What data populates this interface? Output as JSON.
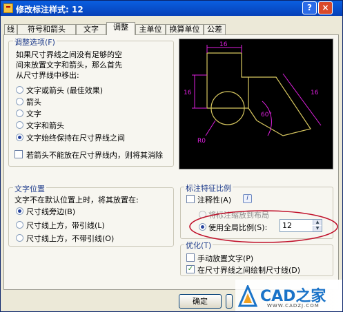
{
  "window": {
    "title": "修改标注样式: 12",
    "help_label": "?",
    "close_label": "×"
  },
  "tabs": [
    {
      "label": "线"
    },
    {
      "label": "符号和箭头"
    },
    {
      "label": "文字"
    },
    {
      "label": "调整",
      "active": true
    },
    {
      "label": "主单位"
    },
    {
      "label": "换算单位"
    },
    {
      "label": "公差"
    }
  ],
  "fit_options": {
    "title": "调整选项(F)",
    "description": [
      "如果尺寸界线之间没有足够的空",
      "间来放置文字和箭头，那么首先",
      "从尺寸界线中移出:"
    ],
    "radios": [
      {
        "label": "文字或箭头 (最佳效果)",
        "selected": false
      },
      {
        "label": "箭头",
        "selected": false
      },
      {
        "label": "文字",
        "selected": false
      },
      {
        "label": "文字和箭头",
        "selected": false
      },
      {
        "label": "文字始终保持在尺寸界线之间",
        "selected": true
      }
    ],
    "suppress_checkbox": {
      "label": "若箭头不能放在尺寸界线内，则将其消除",
      "checked": false
    }
  },
  "text_placement": {
    "title": "文字位置",
    "description": "文字不在默认位置上时，将其放置在:",
    "radios": [
      {
        "label": "尺寸线旁边(B)",
        "selected": true
      },
      {
        "label": "尺寸线上方，带引线(L)",
        "selected": false
      },
      {
        "label": "尺寸线上方，不带引线(O)",
        "selected": false
      }
    ]
  },
  "scale": {
    "title": "标注特征比例",
    "annotative": {
      "label": "注释性(A)",
      "checked": false,
      "info_icon": "i"
    },
    "layout_radio": {
      "label": "将标注缩放到布局",
      "selected": false
    },
    "global_radio": {
      "label": "使用全局比例(S):",
      "selected": true
    },
    "global_value": "12",
    "highlight_color": "#c0102a"
  },
  "finetune": {
    "title": "优化(T)",
    "manual": {
      "label": "手动放置文字(P)",
      "checked": false
    },
    "draw_dimline": {
      "label": "在尺寸界线之间绘制尺寸线(D)",
      "checked": true,
      "check_glyph": "✓"
    }
  },
  "preview": {
    "dims": [
      "16",
      "16",
      "16",
      "60°",
      "R0"
    ],
    "colors": {
      "dimension": "#e020e0",
      "geometry": "#d8c860",
      "background": "#000000"
    }
  },
  "buttons": {
    "ok": "确定"
  },
  "watermark": {
    "brand": "CAD之家",
    "url": "WWW.CADZJ.COM",
    "accent": "#1a73c8"
  }
}
